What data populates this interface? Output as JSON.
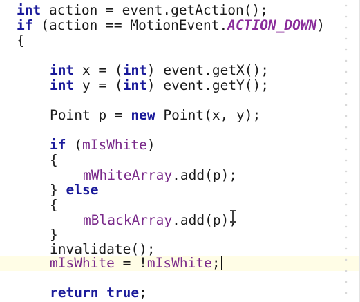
{
  "code": {
    "line1": {
      "kw_int": "int",
      "rest": " action = event.getAction();"
    },
    "line2": {
      "kw_if": "if",
      "pre": " (action == MotionEvent.",
      "const": "ACTION_DOWN",
      "post": ")"
    },
    "line3": {
      "brace": "{"
    },
    "line4": {
      "kw_int": "int",
      "mid1": " x = (",
      "kw_int2": "int",
      "mid2": ") event.getX();"
    },
    "line5": {
      "kw_int": "int",
      "mid1": " y = (",
      "kw_int2": "int",
      "mid2": ") event.getY();"
    },
    "line6": {
      "pre": "Point p = ",
      "kw_new": "new",
      "post": " Point(x, y);"
    },
    "line7": {
      "kw_if": "if",
      "pre": " (",
      "field": "mIsWhite",
      "post": ")"
    },
    "line8": {
      "brace": "{"
    },
    "line9": {
      "field": "mWhiteArray",
      "post": ".add(p);"
    },
    "line10": {
      "pre": "} ",
      "kw_else": "else"
    },
    "line11": {
      "brace": "{"
    },
    "line12": {
      "field": "mBlackArray",
      "post": ".add(p);"
    },
    "line13": {
      "brace": "}"
    },
    "line14": {
      "text": "invalidate();"
    },
    "line15": {
      "field1": "mIsWhite",
      "mid": " = !",
      "field2": "mIsWhite",
      "post": ";"
    },
    "line16": {
      "kw_return": "return",
      "sp": " ",
      "kw_true": "true",
      "post": ";"
    }
  },
  "colors": {
    "keyword": "#1a1a9a",
    "constant": "#8a2c9a",
    "field": "#7a2a8a",
    "current_line_highlight": "#fffde6"
  },
  "icons": {
    "text_cursor": "i-beam-cursor-icon",
    "caret": "text-caret"
  }
}
